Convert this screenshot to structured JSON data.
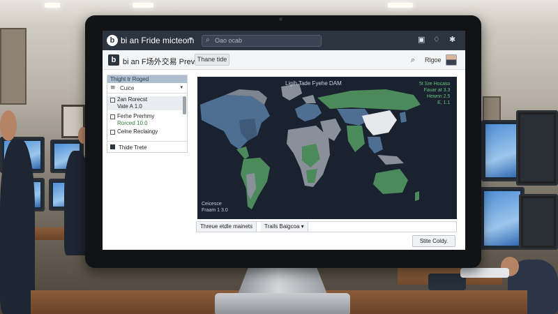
{
  "app": {
    "title": "bi an Fride micteom",
    "search_placeholder": "Oao ocab"
  },
  "subheader": {
    "title": "bi an F场外交易 Preview",
    "button": "Thane tide",
    "user": "Rlgoe"
  },
  "panel": {
    "header": "Thight tr Roged",
    "filter": "Cuice",
    "items": [
      {
        "line1": "2an Rorecst",
        "line2": "Vate A  1.0"
      },
      {
        "line1": "Ferhe Prerhmy",
        "line2": "Rorced  10.0"
      },
      {
        "line1": "Celne Reclaingy",
        "line2": ""
      }
    ],
    "footer": "Thide Trete"
  },
  "map": {
    "title": "Ligih Tade Fyehe DAM",
    "legend": [
      "5t Sre Hocaso",
      "Fauar at 3.3",
      "Hewnn 2.5",
      "E,  1.1"
    ],
    "footer": [
      "Ceicesce",
      "Fraam  1 3.0"
    ]
  },
  "controls": {
    "markets": "Threue etdle mainets",
    "display": "Trails Baigcoa",
    "save": "Stite Coldy."
  },
  "colors": {
    "topbar": "#2c3440",
    "map_ocean": "#1a2230",
    "land_gray": "#8a9099",
    "land_green": "#4c8a5c",
    "land_blue": "#4f6f92",
    "legend_green": "#6ac27a"
  }
}
